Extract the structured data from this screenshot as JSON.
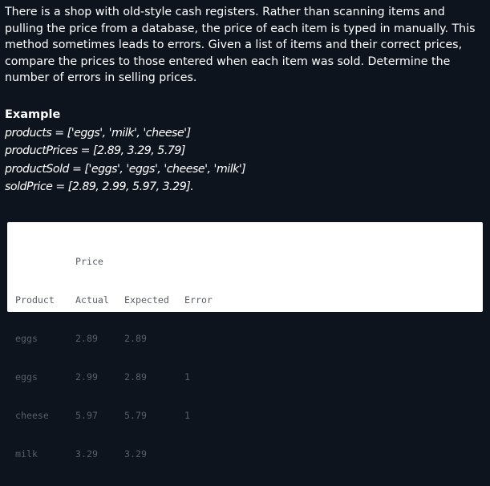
{
  "problem": {
    "text": "There is a shop with old-style cash registers. Rather than scanning items and pulling the price from a database, the price of each item is typed in manually. This method sometimes leads to errors. Given a list of items and their correct prices, compare the prices to those entered when each item was sold. Determine the number of errors in selling prices."
  },
  "example": {
    "heading": "Example",
    "lines": [
      "products = ['eggs', 'milk', 'cheese']",
      "productPrices = [2.89, 3.29, 5.79]",
      "productSold = ['eggs', 'eggs', 'cheese', 'milk']",
      "soldPrice = [2.89, 2.99, 5.97, 3.29]."
    ]
  },
  "table": {
    "group_header": "Price",
    "columns": [
      "Product",
      "Actual",
      "Expected",
      "Error"
    ],
    "rows": [
      {
        "product": "eggs",
        "actual": "2.89",
        "expected": "2.89",
        "error": ""
      },
      {
        "product": "eggs",
        "actual": "2.99",
        "expected": "2.89",
        "error": "1"
      },
      {
        "product": "cheese",
        "actual": "5.97",
        "expected": "5.79",
        "error": "1"
      },
      {
        "product": "milk",
        "actual": "3.29",
        "expected": "3.29",
        "error": ""
      }
    ]
  },
  "colors": {
    "background": "#0e141e",
    "text": "#ffffff",
    "code_background": "#ffffff",
    "code_text": "#5a5f66"
  }
}
